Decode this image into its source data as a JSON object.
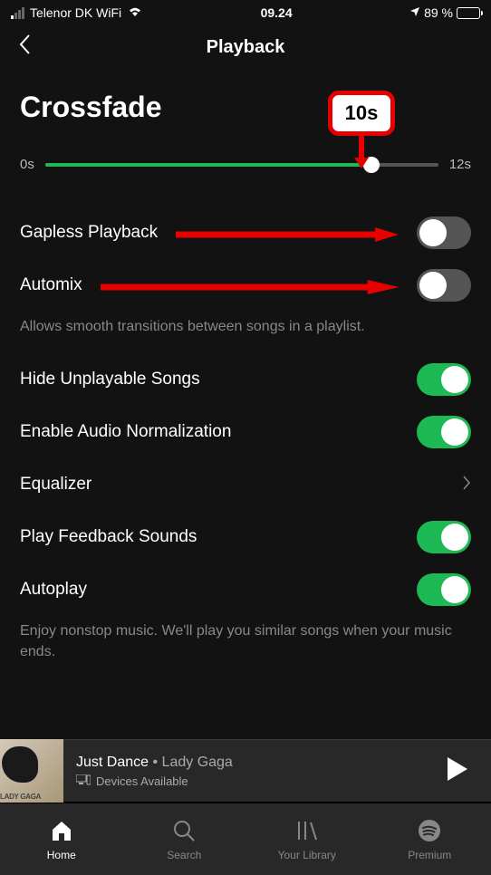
{
  "status": {
    "carrier": "Telenor DK WiFi",
    "time": "09.24",
    "battery_pct": "89 %"
  },
  "nav": {
    "title": "Playback"
  },
  "crossfade": {
    "title": "Crossfade",
    "min_label": "0s",
    "max_label": "12s",
    "callout_value": "10s"
  },
  "settings": {
    "gapless": {
      "label": "Gapless Playback",
      "on": false
    },
    "automix": {
      "label": "Automix",
      "on": false,
      "description": "Allows smooth transitions between songs in a playlist."
    },
    "hide_unplayable": {
      "label": "Hide Unplayable Songs",
      "on": true
    },
    "normalization": {
      "label": "Enable Audio Normalization",
      "on": true
    },
    "equalizer": {
      "label": "Equalizer"
    },
    "feedback": {
      "label": "Play Feedback Sounds",
      "on": true
    },
    "autoplay": {
      "label": "Autoplay",
      "on": true,
      "description": "Enjoy nonstop music. We'll play you similar songs when your music ends."
    }
  },
  "now_playing": {
    "title": "Just Dance",
    "separator": " • ",
    "artist": "Lady Gaga",
    "devices_label": "Devices Available",
    "album_text": "LADY GAGA"
  },
  "tabs": {
    "home": "Home",
    "search": "Search",
    "library": "Your Library",
    "premium": "Premium"
  }
}
